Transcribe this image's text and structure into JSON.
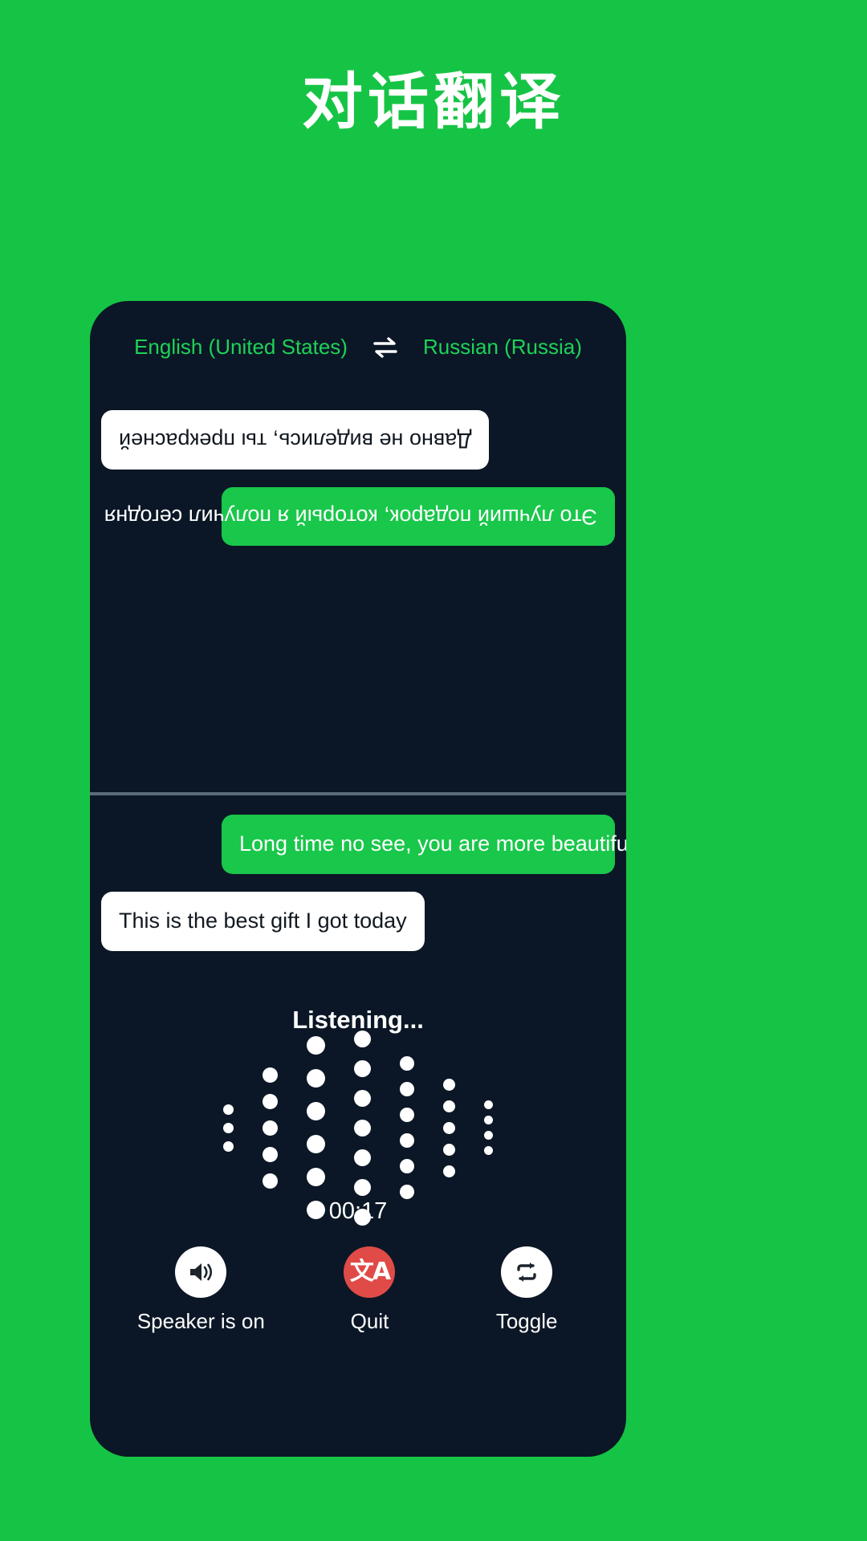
{
  "page": {
    "title": "对话翻译",
    "background_color": "#16c445"
  },
  "phone": {
    "background_color": "#0b1726",
    "language_bar": {
      "source_language": "English (United States)",
      "target_language": "Russian (Russia)",
      "swap_icon": "swap-horizontal-icon",
      "text_color": "#1fd257"
    },
    "conversation_top": {
      "rotated": true,
      "messages": [
        {
          "text": "Это лучший подарок, который я получил сегодня",
          "style": "accent",
          "align": "left",
          "bubble_color": "#19c74a",
          "text_color": "#ffffff"
        },
        {
          "text": "Давно не виделись, ты прекрасней",
          "style": "plain",
          "align": "right",
          "bubble_color": "#ffffff",
          "text_color": "#111820"
        }
      ]
    },
    "conversation_bottom": {
      "messages": [
        {
          "text": "Long time no see, you are more beautiful",
          "style": "accent",
          "align": "right",
          "bubble_color": "#19c74a",
          "text_color": "#ffffff"
        },
        {
          "text": "This is the best gift I got today",
          "style": "plain",
          "align": "left",
          "bubble_color": "#ffffff",
          "text_color": "#111820"
        }
      ]
    },
    "status": {
      "listening_label": "Listening...",
      "timer": "00:17"
    },
    "waveform": {
      "dot_color": "#ffffff",
      "columns": [
        {
          "count": 3,
          "size": 13
        },
        {
          "count": 5,
          "size": 19
        },
        {
          "count": 6,
          "size": 23
        },
        {
          "count": 7,
          "size": 21
        },
        {
          "count": 6,
          "size": 18
        },
        {
          "count": 5,
          "size": 15
        },
        {
          "count": 4,
          "size": 11
        }
      ]
    },
    "controls": [
      {
        "label": "Speaker is on",
        "icon": "speaker-on-icon",
        "circle_style": "light",
        "circle_color": "#ffffff"
      },
      {
        "label": "Quit",
        "icon": "translate-icon",
        "circle_style": "danger",
        "circle_color": "#e04b47",
        "glyph": "文A"
      },
      {
        "label": "Toggle",
        "icon": "repeat-swap-icon",
        "circle_style": "light",
        "circle_color": "#ffffff"
      }
    ]
  }
}
